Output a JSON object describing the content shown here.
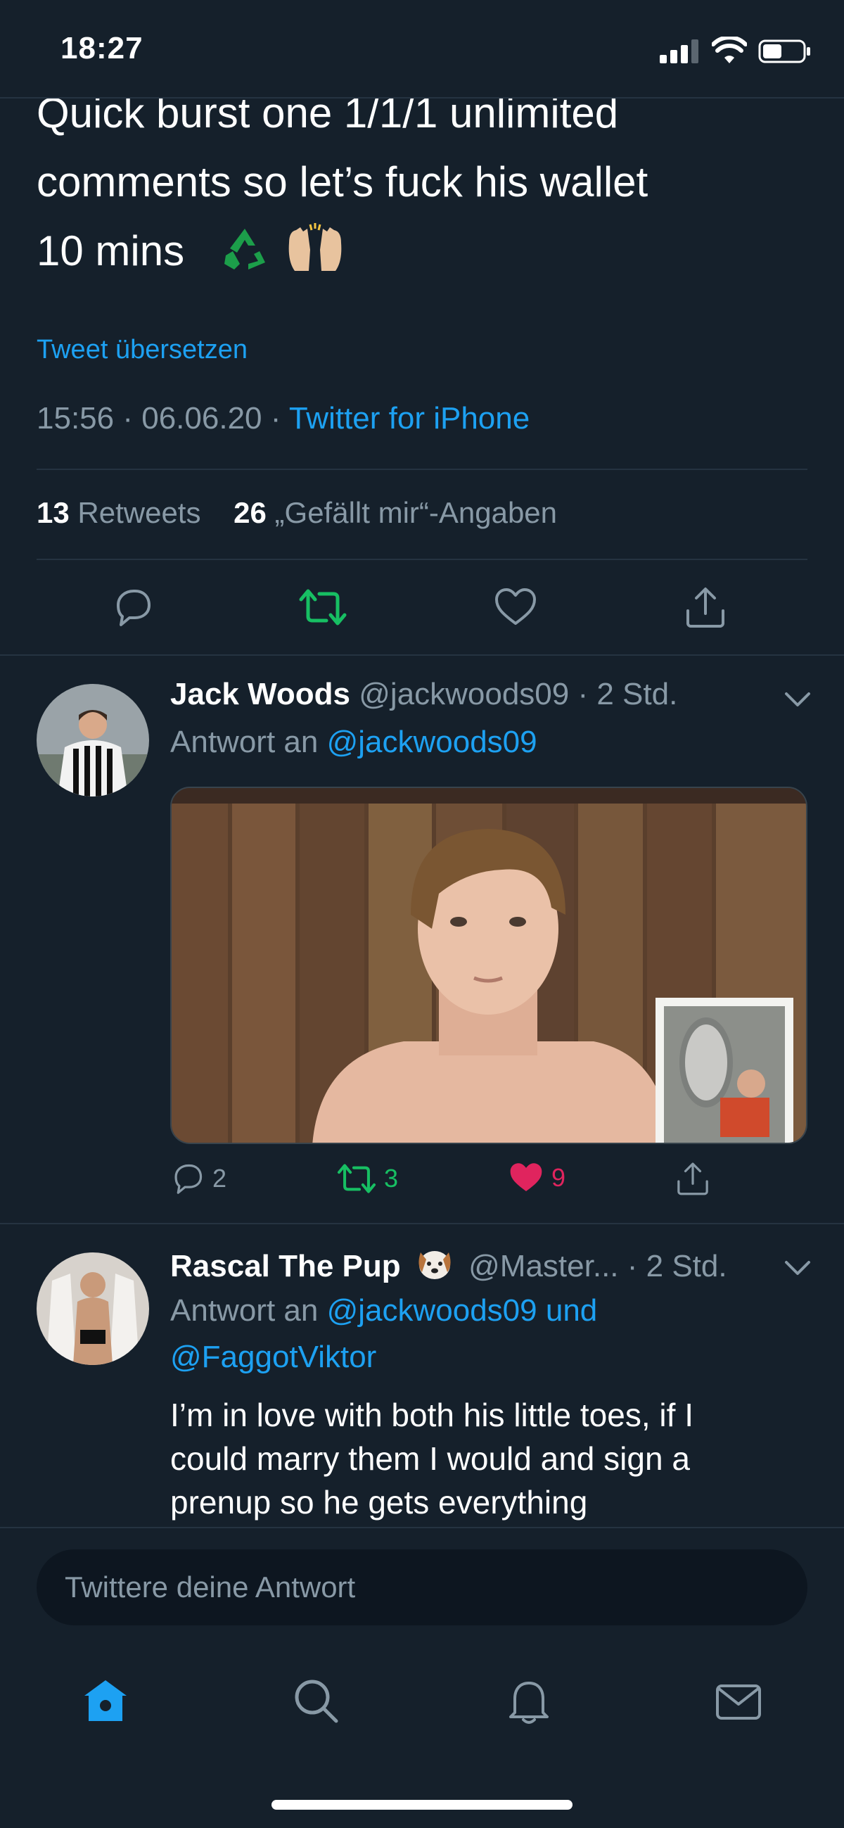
{
  "status": {
    "time": "18:27"
  },
  "tweet": {
    "line1": "Quick burst one 1/1/1 unlimited",
    "line2": "comments so let’s fuck his wallet",
    "line3": "10 mins",
    "translate": "Tweet übersetzen",
    "time": "15:56",
    "date": "06.06.20",
    "source": "Twitter for iPhone",
    "retweet_count": "13",
    "retweet_label": "Retweets",
    "like_count": "26",
    "like_label": "„Gefällt mir“-Angaben"
  },
  "replies": [
    {
      "name": "Jack Woods",
      "handle": "@jackwoods09",
      "time": "· 2 Std.",
      "reply_prefix": "Antwort an",
      "reply_to": "@jackwoods09",
      "reply_count": "2",
      "retweet_count": "3",
      "like_count": "9"
    },
    {
      "name": "Rascal The Pup",
      "handle": "@Master...",
      "time": "· 2 Std.",
      "reply_prefix": "Antwort an",
      "reply_to_1": "@jackwoods09 und",
      "reply_to_2": "@FaggotViktor",
      "text_1": "I’m in love with both his little toes, if I",
      "text_2": "could marry them I would and sign a",
      "text_3": "prenup so he gets everything"
    }
  ],
  "compose": {
    "placeholder": "Twittere deine Antwort"
  },
  "colors": {
    "background": "#15202b",
    "accent": "#1da1f2",
    "retweet_green": "#17bf63",
    "like_red": "#e0245e",
    "muted": "#8899a6"
  },
  "tabs": [
    "home-icon",
    "search-icon",
    "bell-icon",
    "mail-icon"
  ]
}
